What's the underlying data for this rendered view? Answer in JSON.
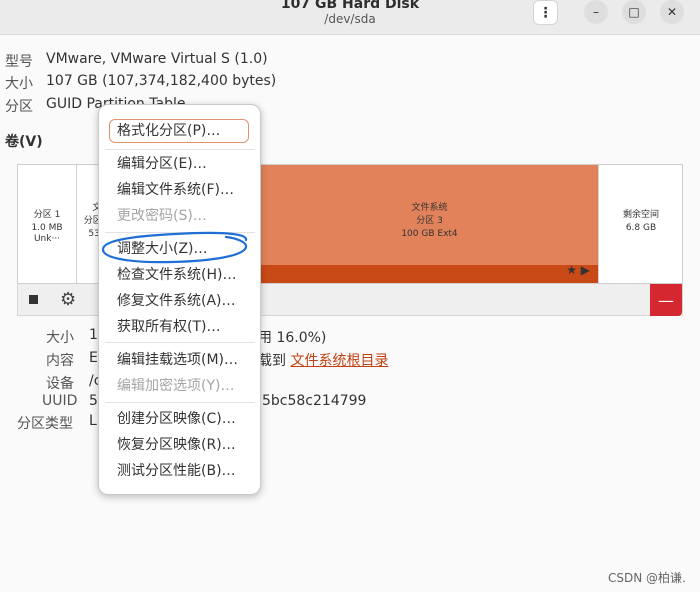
{
  "window": {
    "title": "107 GB Hard Disk",
    "subtitle": "/dev/sda",
    "menu_icon": "⋮",
    "minimize_icon": "–",
    "maximize_icon": "□",
    "close_icon": "✕"
  },
  "disk_info": {
    "model_label": "型号",
    "model_value": "VMware, VMware Virtual S (1.0)",
    "size_label": "大小",
    "size_value": "107 GB (107,374,182,400 bytes)",
    "partitioning_label": "分区",
    "partitioning_value": "GUID Partition Table"
  },
  "volumes": {
    "heading": "卷(V)",
    "segments": [
      {
        "line1": "分区 1",
        "line2": "1.0 MB Unk···"
      },
      {
        "line1": "文",
        "line2": "分区 2",
        "line3": "538"
      },
      {
        "line1": "文件系统",
        "line2": "分区 3",
        "line3": "100 GB Ext4"
      },
      {
        "line1": "剩余空间",
        "line2": "6.8 GB"
      }
    ],
    "seg3_icons": "★ ▶"
  },
  "toolbar": {
    "stop_icon": "■",
    "gear_icon": "⚙",
    "delete_icon": "—"
  },
  "details": {
    "size_label": "大小",
    "size_value_left": "10",
    "size_value_right": "用 16.0%)",
    "content_label": "内容",
    "content_value_left": "E",
    "content_value_mid": "载到",
    "content_link": "文件系统根目录",
    "device_label": "设备",
    "device_value": "/c",
    "uuid_label": "UUID",
    "uuid_value_left": "54",
    "uuid_value_right": "5bc58c214799",
    "ptype_label": "分区类型",
    "ptype_value": "Li"
  },
  "context_menu": {
    "items": [
      {
        "label": "格式化分区(P)…",
        "enabled": true
      },
      {
        "label": "编辑分区(E)…",
        "enabled": true
      },
      {
        "label": "编辑文件系统(F)…",
        "enabled": true
      },
      {
        "label": "更改密码(S)…",
        "enabled": false
      },
      {
        "label": "调整大小(Z)…",
        "enabled": true
      },
      {
        "label": "检查文件系统(H)…",
        "enabled": true
      },
      {
        "label": "修复文件系统(A)…",
        "enabled": true
      },
      {
        "label": "获取所有权(T)…",
        "enabled": true
      },
      {
        "label": "编辑挂载选项(M)…",
        "enabled": true
      },
      {
        "label": "编辑加密选项(Y)…",
        "enabled": false
      },
      {
        "label": "创建分区映像(C)…",
        "enabled": true
      },
      {
        "label": "恢复分区映像(R)…",
        "enabled": true
      },
      {
        "label": "测试分区性能(B)…",
        "enabled": true
      }
    ]
  },
  "watermark": "CSDN @柏谦.",
  "colors": {
    "accent": "#e2825a",
    "accent_dark": "#c94a17",
    "delete": "#d4272f",
    "annotation": "#1f6fd6"
  }
}
